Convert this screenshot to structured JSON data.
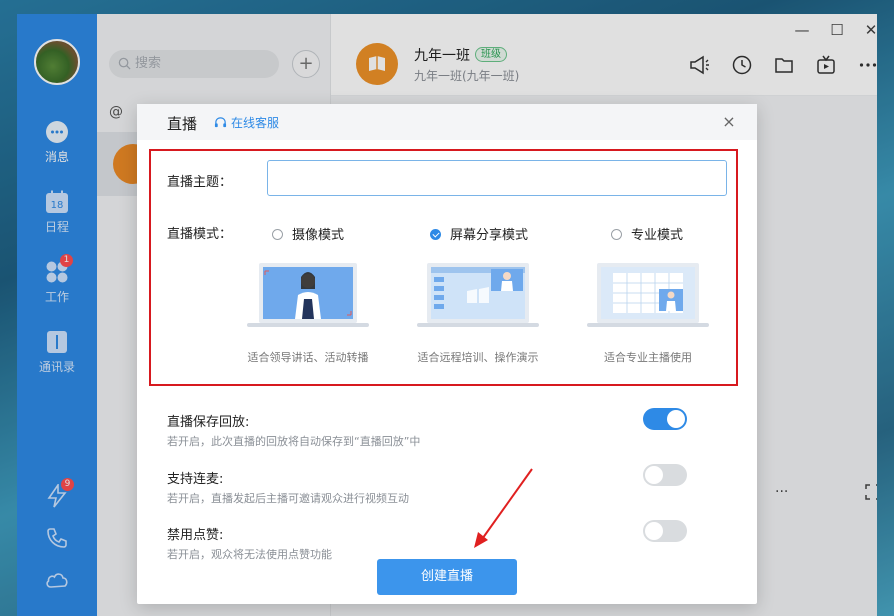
{
  "nav": {
    "items": [
      {
        "label": "消息",
        "icon": "chat-bubble-icon"
      },
      {
        "label": "日程",
        "icon": "calendar-icon",
        "day": "18"
      },
      {
        "label": "工作",
        "icon": "apps-icon",
        "badge": "1"
      },
      {
        "label": "通讯录",
        "icon": "contacts-icon"
      }
    ],
    "bottom": [
      {
        "icon": "lightning-icon",
        "badge": "9"
      },
      {
        "icon": "phone-icon"
      },
      {
        "icon": "cloud-icon"
      }
    ]
  },
  "list": {
    "search_placeholder": "搜索",
    "add_label": "+",
    "at_label": "@"
  },
  "chat": {
    "title": "九年一班",
    "tag": "班级",
    "subtitle": "九年一班(九年一班)"
  },
  "window_controls": {
    "minimize": "—",
    "maximize": "☐",
    "close": "✕"
  },
  "chat_tools": {
    "more": "···"
  },
  "modal": {
    "title": "直播",
    "service_link": "在线客服",
    "close": "×",
    "topic_label": "直播主题：",
    "topic_value": "",
    "mode_label": "直播模式：",
    "modes": [
      {
        "label": "摄像模式",
        "desc": "适合领导讲话、活动转播",
        "checked": false
      },
      {
        "label": "屏幕分享模式",
        "desc": "适合远程培训、操作演示",
        "checked": true
      },
      {
        "label": "专业模式",
        "desc": "适合专业主播使用",
        "checked": false
      }
    ],
    "options": [
      {
        "title": "直播保存回放:",
        "desc": "若开启，此次直播的回放将自动保存到“直播回放”中",
        "on": true
      },
      {
        "title": "支持连麦:",
        "desc": "若开启，直播发起后主播可邀请观众进行视频互动",
        "on": false
      },
      {
        "title": "禁用点赞:",
        "desc": "若开启，观众将无法使用点赞功能",
        "on": false
      }
    ],
    "create_button": "创建直播"
  },
  "colors": {
    "accent": "#2e8ae6",
    "highlight_border": "#d7191f",
    "arrow": "#e02020"
  }
}
